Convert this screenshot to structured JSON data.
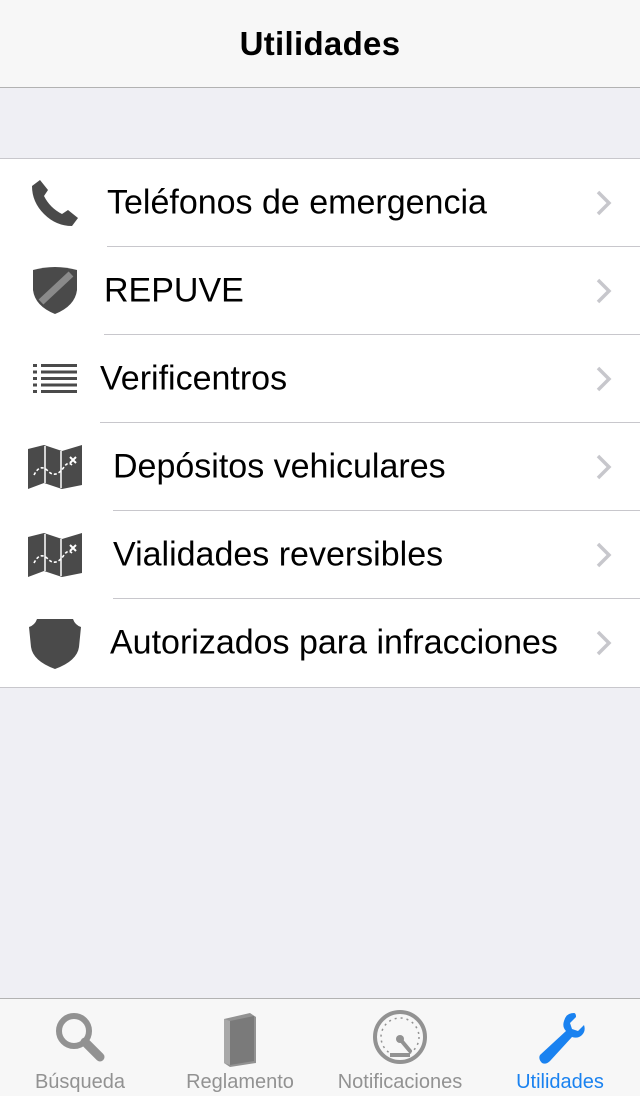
{
  "nav": {
    "title": "Utilidades"
  },
  "rows": [
    {
      "label": "Teléfonos de emergencia",
      "icon": "phone-icon"
    },
    {
      "label": "REPUVE",
      "icon": "shield-icon"
    },
    {
      "label": "Verificentros",
      "icon": "list-icon"
    },
    {
      "label": "Depósitos vehiculares",
      "icon": "map-icon"
    },
    {
      "label": "Vialidades reversibles",
      "icon": "map-icon"
    },
    {
      "label": "Autorizados para infracciones",
      "icon": "badge-icon"
    }
  ],
  "tabs": [
    {
      "label": "Búsqueda",
      "icon": "search-icon",
      "active": false
    },
    {
      "label": "Reglamento",
      "icon": "book-icon",
      "active": false
    },
    {
      "label": "Notificaciones",
      "icon": "gauge-icon",
      "active": false
    },
    {
      "label": "Utilidades",
      "icon": "wrench-icon",
      "active": true
    }
  ],
  "colors": {
    "accent": "#1a82f0",
    "icon_gray": "#4a4a4a",
    "chevron": "#c7c7cc",
    "background": "#efeff4"
  }
}
